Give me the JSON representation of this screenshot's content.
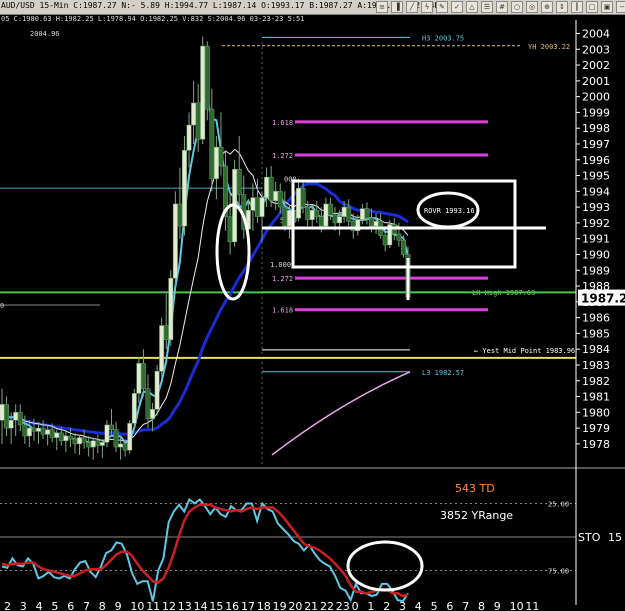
{
  "toolbar": {
    "text": "AUD/USD 15-Min C:1987.27 N:- 5.89 H:1994.77 L:1987.14 O:1993.17 B:1987.27 A:1987.58 V:21.4K",
    "icons": [
      "chart-icon",
      "bars-icon",
      "draw-icon",
      "lightning-icon",
      "pencil-icon",
      "check-icon",
      "triangle-icon",
      "lines-icon",
      "grid-icon",
      "circle-icon",
      "target-icon",
      "magnify-icon",
      "arrows-icon",
      "bars2-icon",
      "square-icon",
      "lock-icon",
      "minus-icon",
      "play-icon"
    ]
  },
  "info_line": "05 C:1980.63 H:1982.25 L:1978.94 O:1982.25 V:832 S:2004.96 03-23-23 5:51",
  "top_label": "2004.96",
  "chart_data": [
    {
      "type": "candlestick",
      "title": "",
      "y_axis": {
        "min": 1976.6,
        "max": 2004.6,
        "ticks": [
          2004,
          2003,
          2002,
          2001,
          2000,
          1999,
          1998,
          1997,
          1996,
          1995,
          1994,
          1993,
          1992,
          1991,
          1990,
          1989,
          1988,
          1987,
          1986,
          1985,
          1984,
          1983,
          1982,
          1981,
          1980,
          1979,
          1978
        ]
      },
      "last_price": "1987.27",
      "candles": [
        [
          1979.5,
          1981.5,
          1978.0,
          1980.5
        ],
        [
          1980.5,
          1981.0,
          1978.5,
          1979.0
        ],
        [
          1979.0,
          1980.0,
          1978.0,
          1979.5
        ],
        [
          1979.5,
          1980.5,
          1978.5,
          1980.0
        ],
        [
          1980.0,
          1980.5,
          1978.8,
          1979.2
        ],
        [
          1979.2,
          1979.8,
          1978.0,
          1978.5
        ],
        [
          1978.5,
          1979.5,
          1977.8,
          1979.0
        ],
        [
          1979.0,
          1979.6,
          1978.2,
          1978.8
        ],
        [
          1978.8,
          1979.4,
          1978.0,
          1979.0
        ],
        [
          1979.0,
          1979.5,
          1978.3,
          1978.6
        ],
        [
          1978.6,
          1979.2,
          1977.9,
          1978.9
        ],
        [
          1978.9,
          1979.3,
          1978.1,
          1978.4
        ],
        [
          1978.4,
          1978.9,
          1977.6,
          1978.7
        ],
        [
          1978.7,
          1979.1,
          1977.9,
          1978.2
        ],
        [
          1978.2,
          1978.8,
          1977.5,
          1978.5
        ],
        [
          1978.5,
          1979.0,
          1977.8,
          1978.3
        ],
        [
          1978.3,
          1978.7,
          1977.4,
          1978.0
        ],
        [
          1978.0,
          1978.6,
          1977.3,
          1978.4
        ],
        [
          1978.4,
          1978.9,
          1977.7,
          1978.1
        ],
        [
          1978.1,
          1978.5,
          1977.2,
          1977.8
        ],
        [
          1977.8,
          1978.4,
          1977.0,
          1978.2
        ],
        [
          1978.2,
          1978.6,
          1977.4,
          1977.9
        ],
        [
          1977.9,
          1978.3,
          1977.1,
          1978.1
        ],
        [
          1978.1,
          1979.5,
          1977.8,
          1979.2
        ],
        [
          1979.2,
          1980.2,
          1978.6,
          1978.9
        ],
        [
          1978.9,
          1979.4,
          1977.5,
          1977.8
        ],
        [
          1977.8,
          1978.4,
          1977.0,
          1978.0
        ],
        [
          1978.0,
          1978.3,
          1977.2,
          1977.6
        ],
        [
          1977.6,
          1979.5,
          1977.4,
          1979.3
        ],
        [
          1979.3,
          1981.5,
          1979.0,
          1981.2
        ],
        [
          1981.2,
          1983.5,
          1980.6,
          1983.1
        ],
        [
          1983.1,
          1984.0,
          1981.0,
          1981.5
        ],
        [
          1981.5,
          1982.4,
          1979.0,
          1979.6
        ],
        [
          1979.6,
          1980.6,
          1978.8,
          1980.2
        ],
        [
          1980.2,
          1983.0,
          1979.8,
          1982.6
        ],
        [
          1982.6,
          1986.0,
          1982.2,
          1985.5
        ],
        [
          1985.5,
          1987.5,
          1984.0,
          1984.6
        ],
        [
          1984.6,
          1989.0,
          1984.2,
          1988.5
        ],
        [
          1988.5,
          1994.0,
          1988.0,
          1993.2
        ],
        [
          1993.2,
          1995.5,
          1991.0,
          1991.8
        ],
        [
          1991.8,
          1997.5,
          1991.2,
          1996.6
        ],
        [
          1996.6,
          1999.0,
          1995.5,
          1998.2
        ],
        [
          1998.2,
          2001.0,
          1997.0,
          1999.6
        ],
        [
          1999.6,
          2000.8,
          1996.5,
          1997.3
        ],
        [
          1997.3,
          2003.8,
          1997.0,
          2003.2
        ],
        [
          2003.2,
          2003.5,
          1998.5,
          1999.2
        ],
        [
          1999.2,
          2000.5,
          1994.0,
          1994.8
        ],
        [
          1994.8,
          1997.5,
          1993.5,
          1996.8
        ],
        [
          1996.8,
          1999.0,
          1995.0,
          1995.6
        ],
        [
          1995.6,
          1996.6,
          1991.5,
          1992.4
        ],
        [
          1992.4,
          1994.0,
          1990.0,
          1990.8
        ],
        [
          1990.8,
          1996.0,
          1990.5,
          1995.4
        ],
        [
          1995.4,
          1997.5,
          1993.0,
          1993.8
        ],
        [
          1993.8,
          1995.0,
          1991.0,
          1991.6
        ],
        [
          1991.6,
          1993.5,
          1990.5,
          1992.8
        ],
        [
          1992.8,
          1994.5,
          1991.5,
          1993.6
        ],
        [
          1993.6,
          1994.8,
          1992.0,
          1992.4
        ],
        [
          1992.4,
          1994.0,
          1990.8,
          1993.6
        ],
        [
          1993.6,
          1995.5,
          1993.0,
          1994.9
        ],
        [
          1994.9,
          1995.6,
          1993.0,
          1993.4
        ],
        [
          1993.4,
          1994.6,
          1992.8,
          1994.0
        ],
        [
          1994.0,
          1994.5,
          1992.6,
          1993.0
        ]
      ],
      "right_candles": [
        [
          1993.0,
          1994.0,
          1991.5,
          1991.8
        ],
        [
          1991.8,
          1993.2,
          1991.0,
          1992.8
        ],
        [
          1992.8,
          1993.6,
          1992.0,
          1992.3
        ],
        [
          1992.3,
          1994.8,
          1992.1,
          1994.2
        ],
        [
          1994.2,
          1994.6,
          1992.6,
          1993.0
        ],
        [
          1993.0,
          1993.4,
          1991.8,
          1992.2
        ],
        [
          1992.2,
          1993.1,
          1991.6,
          1992.8
        ],
        [
          1992.8,
          1993.4,
          1992.0,
          1992.4
        ],
        [
          1992.4,
          1993.0,
          1991.4,
          1991.8
        ],
        [
          1991.8,
          1993.6,
          1991.6,
          1993.2
        ],
        [
          1993.2,
          1993.6,
          1992.2,
          1992.5
        ],
        [
          1992.5,
          1993.0,
          1991.5,
          1992.0
        ],
        [
          1992.0,
          1992.8,
          1991.2,
          1992.4
        ],
        [
          1992.4,
          1993.4,
          1992.0,
          1993.0
        ],
        [
          1993.0,
          1993.5,
          1991.8,
          1992.1
        ],
        [
          1992.1,
          1992.6,
          1991.0,
          1991.5
        ],
        [
          1991.5,
          1992.5,
          1991.2,
          1992.2
        ],
        [
          1992.2,
          1993.2,
          1991.9,
          1992.9
        ],
        [
          1992.9,
          1993.3,
          1991.9,
          1992.3
        ],
        [
          1992.3,
          1992.9,
          1991.4,
          1991.8
        ],
        [
          1991.8,
          1992.6,
          1991.3,
          1992.1
        ],
        [
          1992.1,
          1992.6,
          1991.0,
          1991.2
        ],
        [
          1991.2,
          1991.8,
          1990.2,
          1990.6
        ],
        [
          1990.6,
          1992.2,
          1990.4,
          1991.9
        ],
        [
          1991.9,
          1992.3,
          1990.9,
          1991.3
        ],
        [
          1991.3,
          1992.0,
          1990.5,
          1990.9
        ],
        [
          1990.9,
          1991.2,
          1989.8,
          1990.0
        ],
        [
          1990.0,
          1990.5,
          1987.1,
          1987.3
        ]
      ],
      "horizontal_lines": [
        {
          "label": "H3 2003.75",
          "value": 2003.75,
          "color": "#5ec8e6"
        },
        {
          "label": "YH 2003.22",
          "value": 2003.22,
          "color": "#d9c27a"
        },
        {
          "label": "LH High 1987.63",
          "value": 1987.63,
          "color": "#7fdc6a"
        },
        {
          "label": "← Yest Mid Point 1983.96",
          "value": 1983.96,
          "color": "#ffffff"
        },
        {
          "label": "L3 1982.57",
          "value": 1982.57,
          "color": "#5ec8e6"
        },
        {
          "label": "",
          "value": 1987.6,
          "color": "#4cc84c"
        },
        {
          "label": "",
          "value": 1983.45,
          "color": "#e8e060"
        }
      ],
      "fib_levels": [
        {
          "label": "1.618",
          "value": 1998.4
        },
        {
          "label": "1.272",
          "value": 1996.3
        },
        {
          "label": "1.272",
          "value": 1988.5
        },
        {
          "label": "1.618",
          "value": 1986.5
        }
      ],
      "zone_labels": {
        "top": "000",
        "bottom": "1.000",
        "mid": "50.0"
      },
      "annotation": "ROVR 1993.16",
      "left_markers": [
        "0"
      ]
    },
    {
      "type": "line",
      "title": "",
      "labels": [
        "543 TD",
        "3852 YRange"
      ],
      "indicator": "STO",
      "indicator_value": "15",
      "y_ticks": [
        "25.00",
        "75.00"
      ],
      "series": [
        {
          "color": "#5ec8e6",
          "values": [
            72,
            73,
            66,
            71,
            72,
            66,
            70,
            81,
            79,
            76,
            80,
            81,
            79,
            81,
            74,
            69,
            68,
            76,
            80,
            72,
            62,
            60,
            54,
            55,
            63,
            77,
            85,
            83,
            83,
            98,
            75,
            66,
            39,
            31,
            26,
            31,
            22,
            25,
            22,
            27,
            33,
            28,
            33,
            35,
            27,
            30,
            30,
            25,
            25,
            38,
            25,
            29,
            31,
            40,
            44,
            48,
            53,
            55,
            60,
            56,
            62,
            67,
            70,
            72,
            79,
            88,
            90,
            97,
            85,
            92,
            92,
            94,
            93,
            85,
            85,
            90,
            97,
            98,
            92
          ]
        },
        {
          "color": "#cc2020",
          "values": [
            70,
            71,
            70,
            70,
            70,
            69,
            69,
            72,
            74,
            75,
            76,
            77,
            78,
            79,
            79,
            77,
            75,
            74,
            74,
            74,
            71,
            67,
            63,
            61,
            61,
            64,
            70,
            75,
            79,
            83,
            84,
            81,
            73,
            62,
            49,
            38,
            31,
            28,
            26,
            26,
            26,
            28,
            29,
            30,
            31,
            30,
            31,
            29,
            28,
            29,
            28,
            28,
            28,
            31,
            35,
            40,
            45,
            50,
            55,
            57,
            58,
            60,
            63,
            66,
            70,
            74,
            79,
            86,
            91,
            91,
            92,
            91,
            90,
            89,
            89,
            92,
            92,
            94,
            93
          ]
        }
      ]
    }
  ],
  "x_axis_labels": [
    "2",
    "3",
    "4",
    "5",
    "6",
    "7",
    "8",
    "9",
    "10",
    "11",
    "12",
    "13",
    "14",
    "15",
    "16",
    "17",
    "18",
    "19",
    "20",
    "21",
    "22",
    "23",
    "0",
    "1",
    "2",
    "3",
    "4",
    "5",
    "6",
    "7",
    "8",
    "9",
    "10",
    "11"
  ]
}
